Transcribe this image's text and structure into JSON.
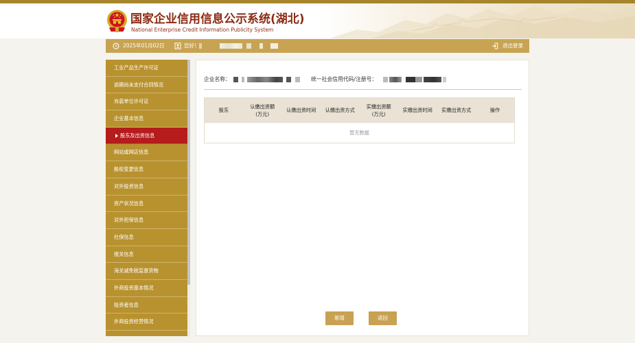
{
  "header": {
    "title": "国家企业信用信息公示系统(湖北)",
    "subtitle": "National Enterprise Credit Information Publicity System",
    "emblem_icon": "national-emblem-icon"
  },
  "topbar": {
    "date": "2025年01月02日",
    "greeting": "您好！",
    "logout_label": "退出登录",
    "date_icon": "clock-icon",
    "user_icon": "user-icon",
    "logout_icon": "logout-icon"
  },
  "sidebar": {
    "active_index": 4,
    "active_icon": "caret-right-icon",
    "items": [
      {
        "label": "工业产品生产许可证"
      },
      {
        "label": "逾期尚未支付合同情况"
      },
      {
        "label": "充装单位许可证"
      },
      {
        "label": "企业基本信息"
      },
      {
        "label": "股东及出资信息"
      },
      {
        "label": "网站或网店信息"
      },
      {
        "label": "股权变更信息"
      },
      {
        "label": "对外投资信息"
      },
      {
        "label": "资产状况信息"
      },
      {
        "label": "对外担保信息"
      },
      {
        "label": "社保信息"
      },
      {
        "label": "报关信息"
      },
      {
        "label": "海关减免税监督货物"
      },
      {
        "label": "外商投资基本情况"
      },
      {
        "label": "投资者信息"
      },
      {
        "label": "外商投资经营情况"
      }
    ]
  },
  "main": {
    "company_name_label": "企业名称：",
    "credit_code_label": "统一社会信用代码/注册号：",
    "table": {
      "columns": [
        "股东",
        "认缴出资额\n(万元)",
        "认缴出资时间",
        "认缴出资方式",
        "实缴出资额\n(万元)",
        "实缴出资时间",
        "实缴出资方式",
        "操作"
      ],
      "rows": [],
      "empty_text": "暂无数据"
    },
    "buttons": {
      "add_label": "新增",
      "back_label": "返回"
    }
  },
  "colors": {
    "gold": "#c8a452",
    "sidebar_gold": "#b8922f",
    "active_red": "#b51c1c",
    "title_brown": "#8c2b14",
    "table_header_bg": "#ebe2d6",
    "page_bg": "#f5f3ee",
    "button_gold": "#c8a152"
  }
}
